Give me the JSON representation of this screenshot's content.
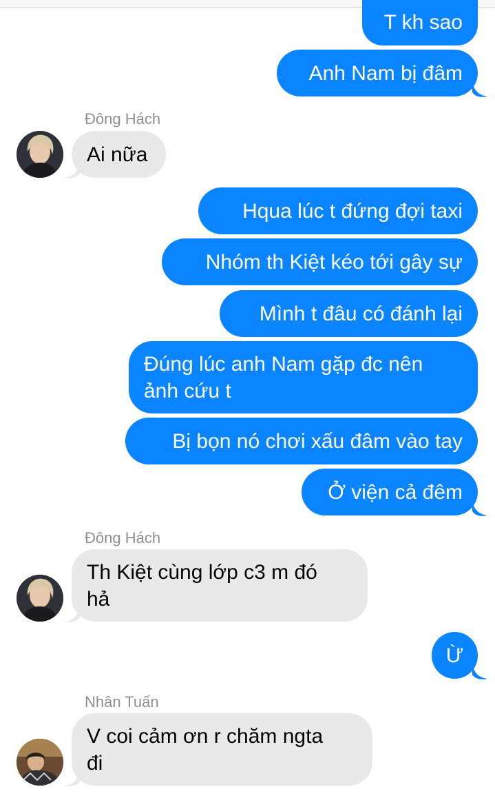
{
  "conversation": {
    "messages": [
      {
        "type": "outgoing",
        "text": "T kh sao"
      },
      {
        "type": "outgoing",
        "text": "Anh Nam bị đâm"
      },
      {
        "type": "incoming",
        "sender": "Đông Hách",
        "text": "Ai nữa"
      },
      {
        "type": "outgoing",
        "text": "Hqua lúc t đứng đợi taxi"
      },
      {
        "type": "outgoing",
        "text": "Nhóm th Kiệt kéo tới gây sự"
      },
      {
        "type": "outgoing",
        "text": "Mình t đâu có đánh lại"
      },
      {
        "type": "outgoing",
        "lines": [
          "Đúng lúc anh Nam gặp đc nên",
          "ảnh cứu t"
        ]
      },
      {
        "type": "outgoing",
        "text": "Bị bọn nó chơi xấu đâm vào tay"
      },
      {
        "type": "outgoing",
        "text": "Ở viện cả đêm"
      },
      {
        "type": "incoming",
        "sender": "Đông Hách",
        "lines": [
          "Th Kiệt cùng lớp c3 m đó",
          "hả"
        ]
      },
      {
        "type": "outgoing",
        "text": "Ừ"
      },
      {
        "type": "incoming",
        "sender": "Nhân Tuấn",
        "lines": [
          "V coi cảm ơn r chăm ngta",
          "đi"
        ]
      }
    ]
  },
  "colors": {
    "outgoing_bubble": "#0a84ff",
    "incoming_bubble": "#e9e9eb",
    "sender_name": "#8e8e93"
  }
}
